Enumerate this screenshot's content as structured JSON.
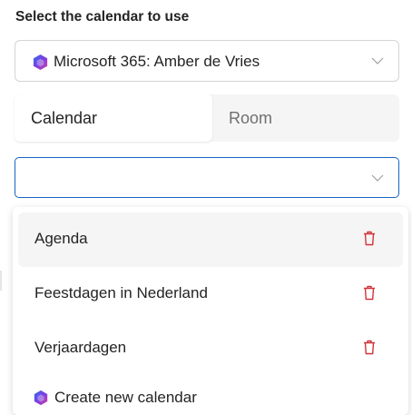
{
  "heading": "Select the calendar to use",
  "account_select": {
    "value": "Microsoft 365: Amber de Vries",
    "icon": "microsoft-365-icon"
  },
  "tabs": [
    {
      "label": "Calendar",
      "active": true
    },
    {
      "label": "Room",
      "active": false
    }
  ],
  "calendar_select": {
    "value": ""
  },
  "dropdown": {
    "options": [
      {
        "label": "Agenda",
        "icon": "trash-icon"
      },
      {
        "label": "Feestdagen in Nederland",
        "icon": "trash-icon"
      },
      {
        "label": "Verjaardagen",
        "icon": "trash-icon"
      }
    ],
    "create_label": "Create new calendar"
  },
  "colors": {
    "accent": "#1464c8",
    "delete": "#d13438"
  }
}
